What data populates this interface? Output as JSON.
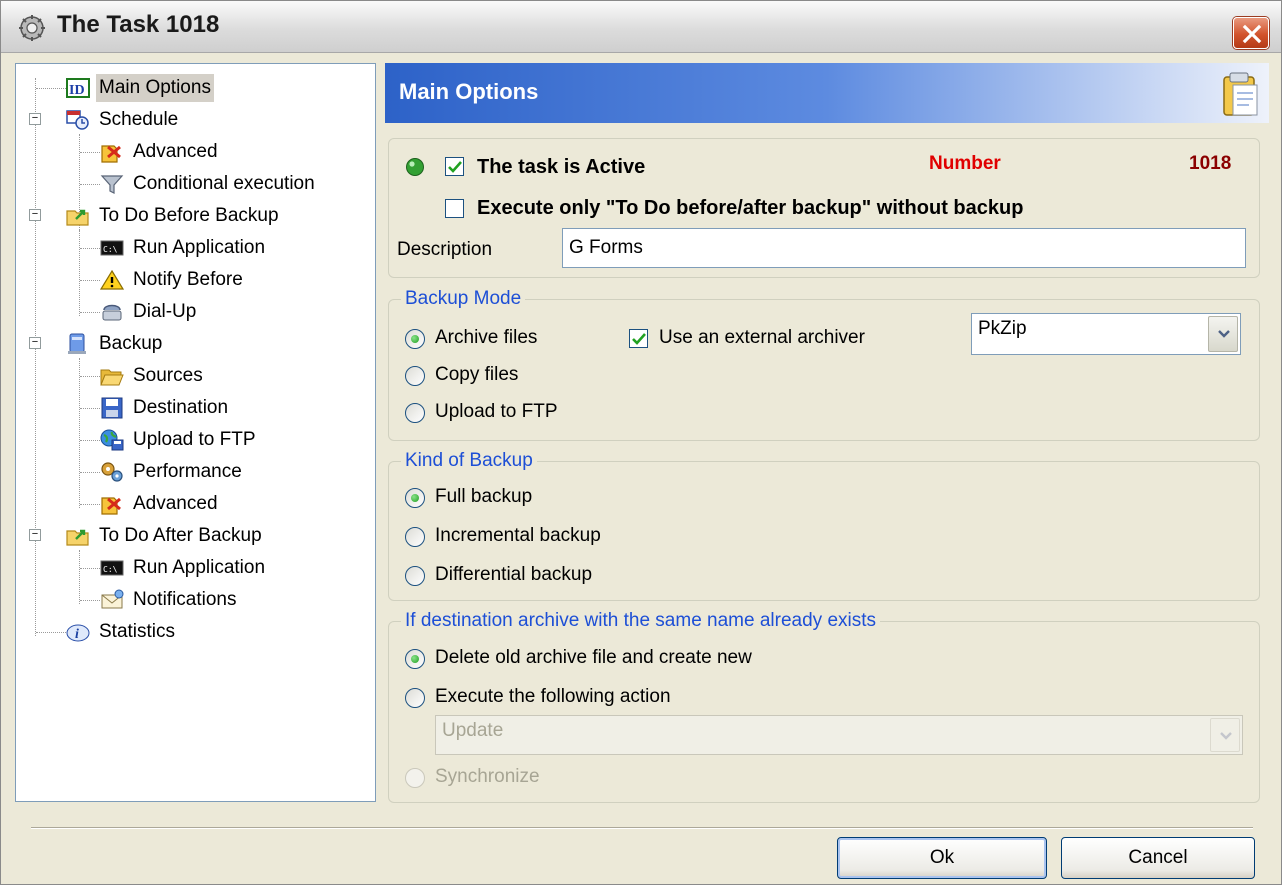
{
  "window": {
    "title": "The Task 1018"
  },
  "tree": {
    "items": [
      {
        "label": "Main Options",
        "icon": "id-icon"
      },
      {
        "label": "Schedule",
        "icon": "calendar-clock-icon"
      },
      {
        "label": "Advanced",
        "icon": "advanced-settings-icon"
      },
      {
        "label": "Conditional execution",
        "icon": "funnel-icon"
      },
      {
        "label": "To Do Before Backup",
        "icon": "folder-arrow-icon"
      },
      {
        "label": "Run Application",
        "icon": "console-icon"
      },
      {
        "label": "Notify Before",
        "icon": "warning-icon"
      },
      {
        "label": "Dial-Up",
        "icon": "dialup-icon"
      },
      {
        "label": "Backup",
        "icon": "computer-icon"
      },
      {
        "label": "Sources",
        "icon": "folder-open-icon"
      },
      {
        "label": "Destination",
        "icon": "floppy-disk-icon"
      },
      {
        "label": "Upload to FTP",
        "icon": "globe-disk-icon"
      },
      {
        "label": "Performance",
        "icon": "gears-icon"
      },
      {
        "label": "Advanced",
        "icon": "advanced-settings-icon"
      },
      {
        "label": "To Do After Backup",
        "icon": "folder-arrow-icon"
      },
      {
        "label": "Run Application",
        "icon": "console-icon"
      },
      {
        "label": "Notifications",
        "icon": "envelope-icon"
      },
      {
        "label": "Statistics",
        "icon": "info-icon"
      }
    ]
  },
  "header": {
    "title": "Main Options"
  },
  "task": {
    "active_label": "The task is Active",
    "active_checked": true,
    "number_label": "Number",
    "number_value": "1018",
    "execute_only_label": "Execute only \"To Do before/after backup\" without backup",
    "execute_only_checked": false,
    "description_label": "Description",
    "description_value": "G Forms"
  },
  "backup_mode": {
    "title": "Backup Mode",
    "options": [
      "Archive files",
      "Copy files",
      "Upload to FTP"
    ],
    "selected": "Archive files",
    "external_archiver_label": "Use an external archiver",
    "external_archiver_checked": true,
    "archiver_value": "PkZip"
  },
  "kind_of_backup": {
    "title": "Kind of Backup",
    "options": [
      "Full backup",
      "Incremental backup",
      "Differential backup"
    ],
    "selected": "Full backup"
  },
  "destination_exists": {
    "title": "If destination archive with the same name already exists",
    "options": [
      "Delete old archive file and create new",
      "Execute the following action"
    ],
    "selected": "Delete old archive file and create new",
    "action_value": "Update",
    "synchronize_label": "Synchronize"
  },
  "buttons": {
    "ok": "Ok",
    "cancel": "Cancel"
  },
  "colors": {
    "number_label": "#e00000",
    "number_value": "#8b0000",
    "group_title": "#1d4fd6",
    "header_gradient_start": "#2d62c8",
    "status_led": "#2e9a2e"
  }
}
